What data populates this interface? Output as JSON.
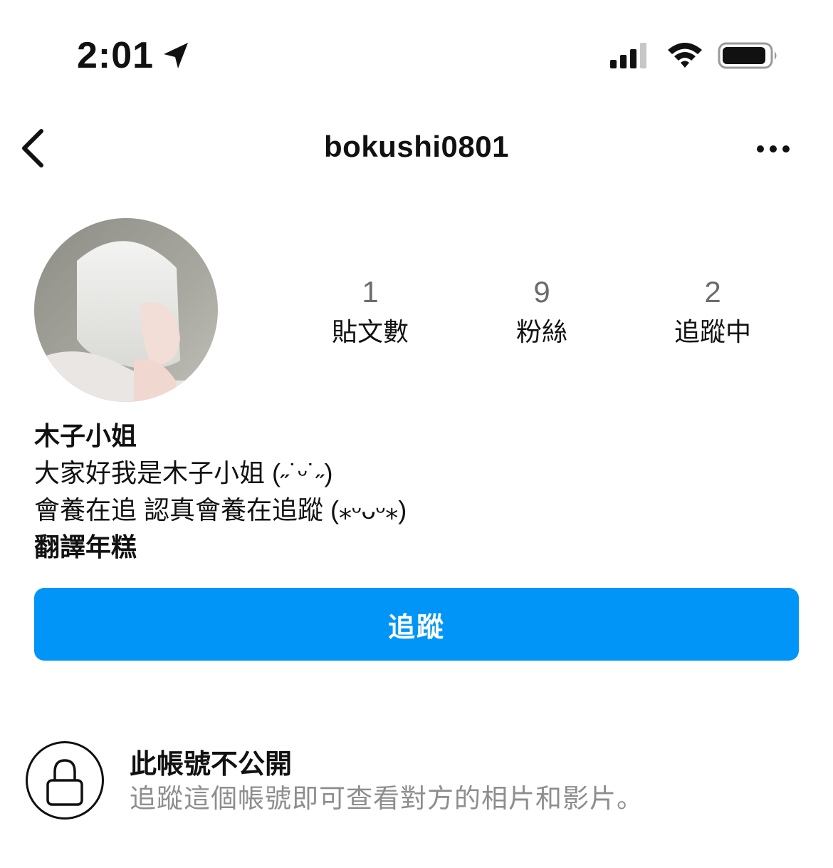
{
  "status_bar": {
    "time": "2:01",
    "icons": [
      "location-arrow-icon",
      "cellular-signal-icon",
      "wifi-icon",
      "battery-icon"
    ]
  },
  "nav": {
    "username": "bokushi0801",
    "back_icon": "chevron-left-icon",
    "more_icon": "more-dots-icon"
  },
  "stats": [
    {
      "value": "1",
      "label": "貼文數"
    },
    {
      "value": "9",
      "label": "粉絲"
    },
    {
      "value": "2",
      "label": "追蹤中"
    }
  ],
  "bio": {
    "name": "木子小姐",
    "line1": "大家好我是木子小姐 (˶˙ᵕ˙˶)",
    "line2": "會養在追 認真會養在追蹤 (⁎ᵕᴗᵕ⁎)",
    "line3": "翻譯年糕"
  },
  "follow_button": "追蹤",
  "private": {
    "title": "此帳號不公開",
    "description": "追蹤這個帳號即可查看對方的相片和影片。"
  },
  "colors": {
    "accent": "#0095f6",
    "muted": "#8e8e8e"
  }
}
